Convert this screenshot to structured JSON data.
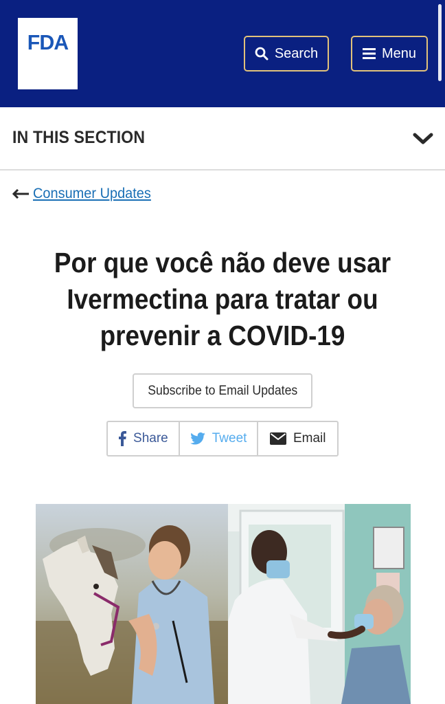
{
  "header": {
    "logo_text": "FDA",
    "search_label": "Search",
    "menu_label": "Menu",
    "background": "#0a2081",
    "button_border": "#e2c27a"
  },
  "section_nav": {
    "label": "IN THIS SECTION",
    "icon": "chevron-down-icon"
  },
  "breadcrumb": {
    "back_label": "Consumer Updates",
    "icon": "arrow-left-icon"
  },
  "article": {
    "title_line1": "Por que você não deve usar",
    "title_line2": "Ivermectina para tratar ou",
    "title_line3": "prevenir a COVID-19"
  },
  "subscribe": {
    "label": "Subscribe to Email Updates"
  },
  "share": {
    "facebook_label": "Share",
    "twitter_label": "Tweet",
    "email_label": "Email",
    "facebook_color": "#3b5998",
    "twitter_color": "#55acee"
  },
  "hero_image": {
    "left_icon": "veterinarian-with-horse-photo",
    "right_icon": "doctor-examining-patient-photo"
  }
}
